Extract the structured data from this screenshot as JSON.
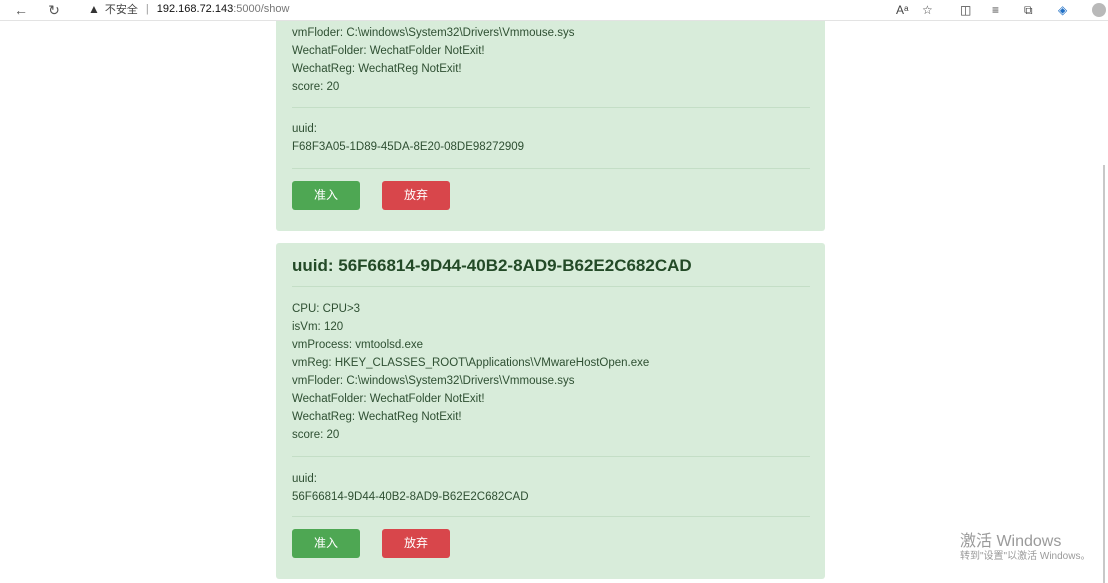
{
  "browser": {
    "insecure_label": "不安全",
    "url_host": "192.168.72.143",
    "url_path": ":5000/show",
    "icons": [
      "back-icon",
      "reload-icon",
      "warning-icon",
      "read-aloud-icon",
      "favorite-add-icon",
      "split-screen-icon",
      "favorites-icon",
      "collections-icon",
      "browser-essentials-icon",
      "profile-avatar"
    ]
  },
  "card1": {
    "lines": [
      "vmFloder: C:\\windows\\System32\\Drivers\\Vmmouse.sys",
      "WechatFolder: WechatFolder NotExit!",
      "WechatReg: WechatReg NotExit!",
      "score: 20"
    ],
    "uuid_label": "uuid:",
    "uuid_value": "F68F3A05-1D89-45DA-8E20-08DE98272909",
    "accept_label": "准入",
    "reject_label": "放弃"
  },
  "card2": {
    "title": "uuid: 56F66814-9D44-40B2-8AD9-B62E2C682CAD",
    "lines": [
      "CPU: CPU>3",
      "isVm: 120",
      "vmProcess: vmtoolsd.exe",
      "vmReg: HKEY_CLASSES_ROOT\\Applications\\VMwareHostOpen.exe",
      "vmFloder: C:\\windows\\System32\\Drivers\\Vmmouse.sys",
      "WechatFolder: WechatFolder NotExit!",
      "WechatReg: WechatReg NotExit!",
      "score: 20"
    ],
    "uuid_label": "uuid:",
    "uuid_value": "56F66814-9D44-40B2-8AD9-B62E2C682CAD",
    "accept_label": "准入",
    "reject_label": "放弃"
  },
  "watermark": {
    "line1": "激活 Windows",
    "line2": "转到\"设置\"以激活 Windows。"
  },
  "colors": {
    "card_bg": "#d8ecda",
    "accept": "#4ea753",
    "reject": "#d8464b"
  }
}
